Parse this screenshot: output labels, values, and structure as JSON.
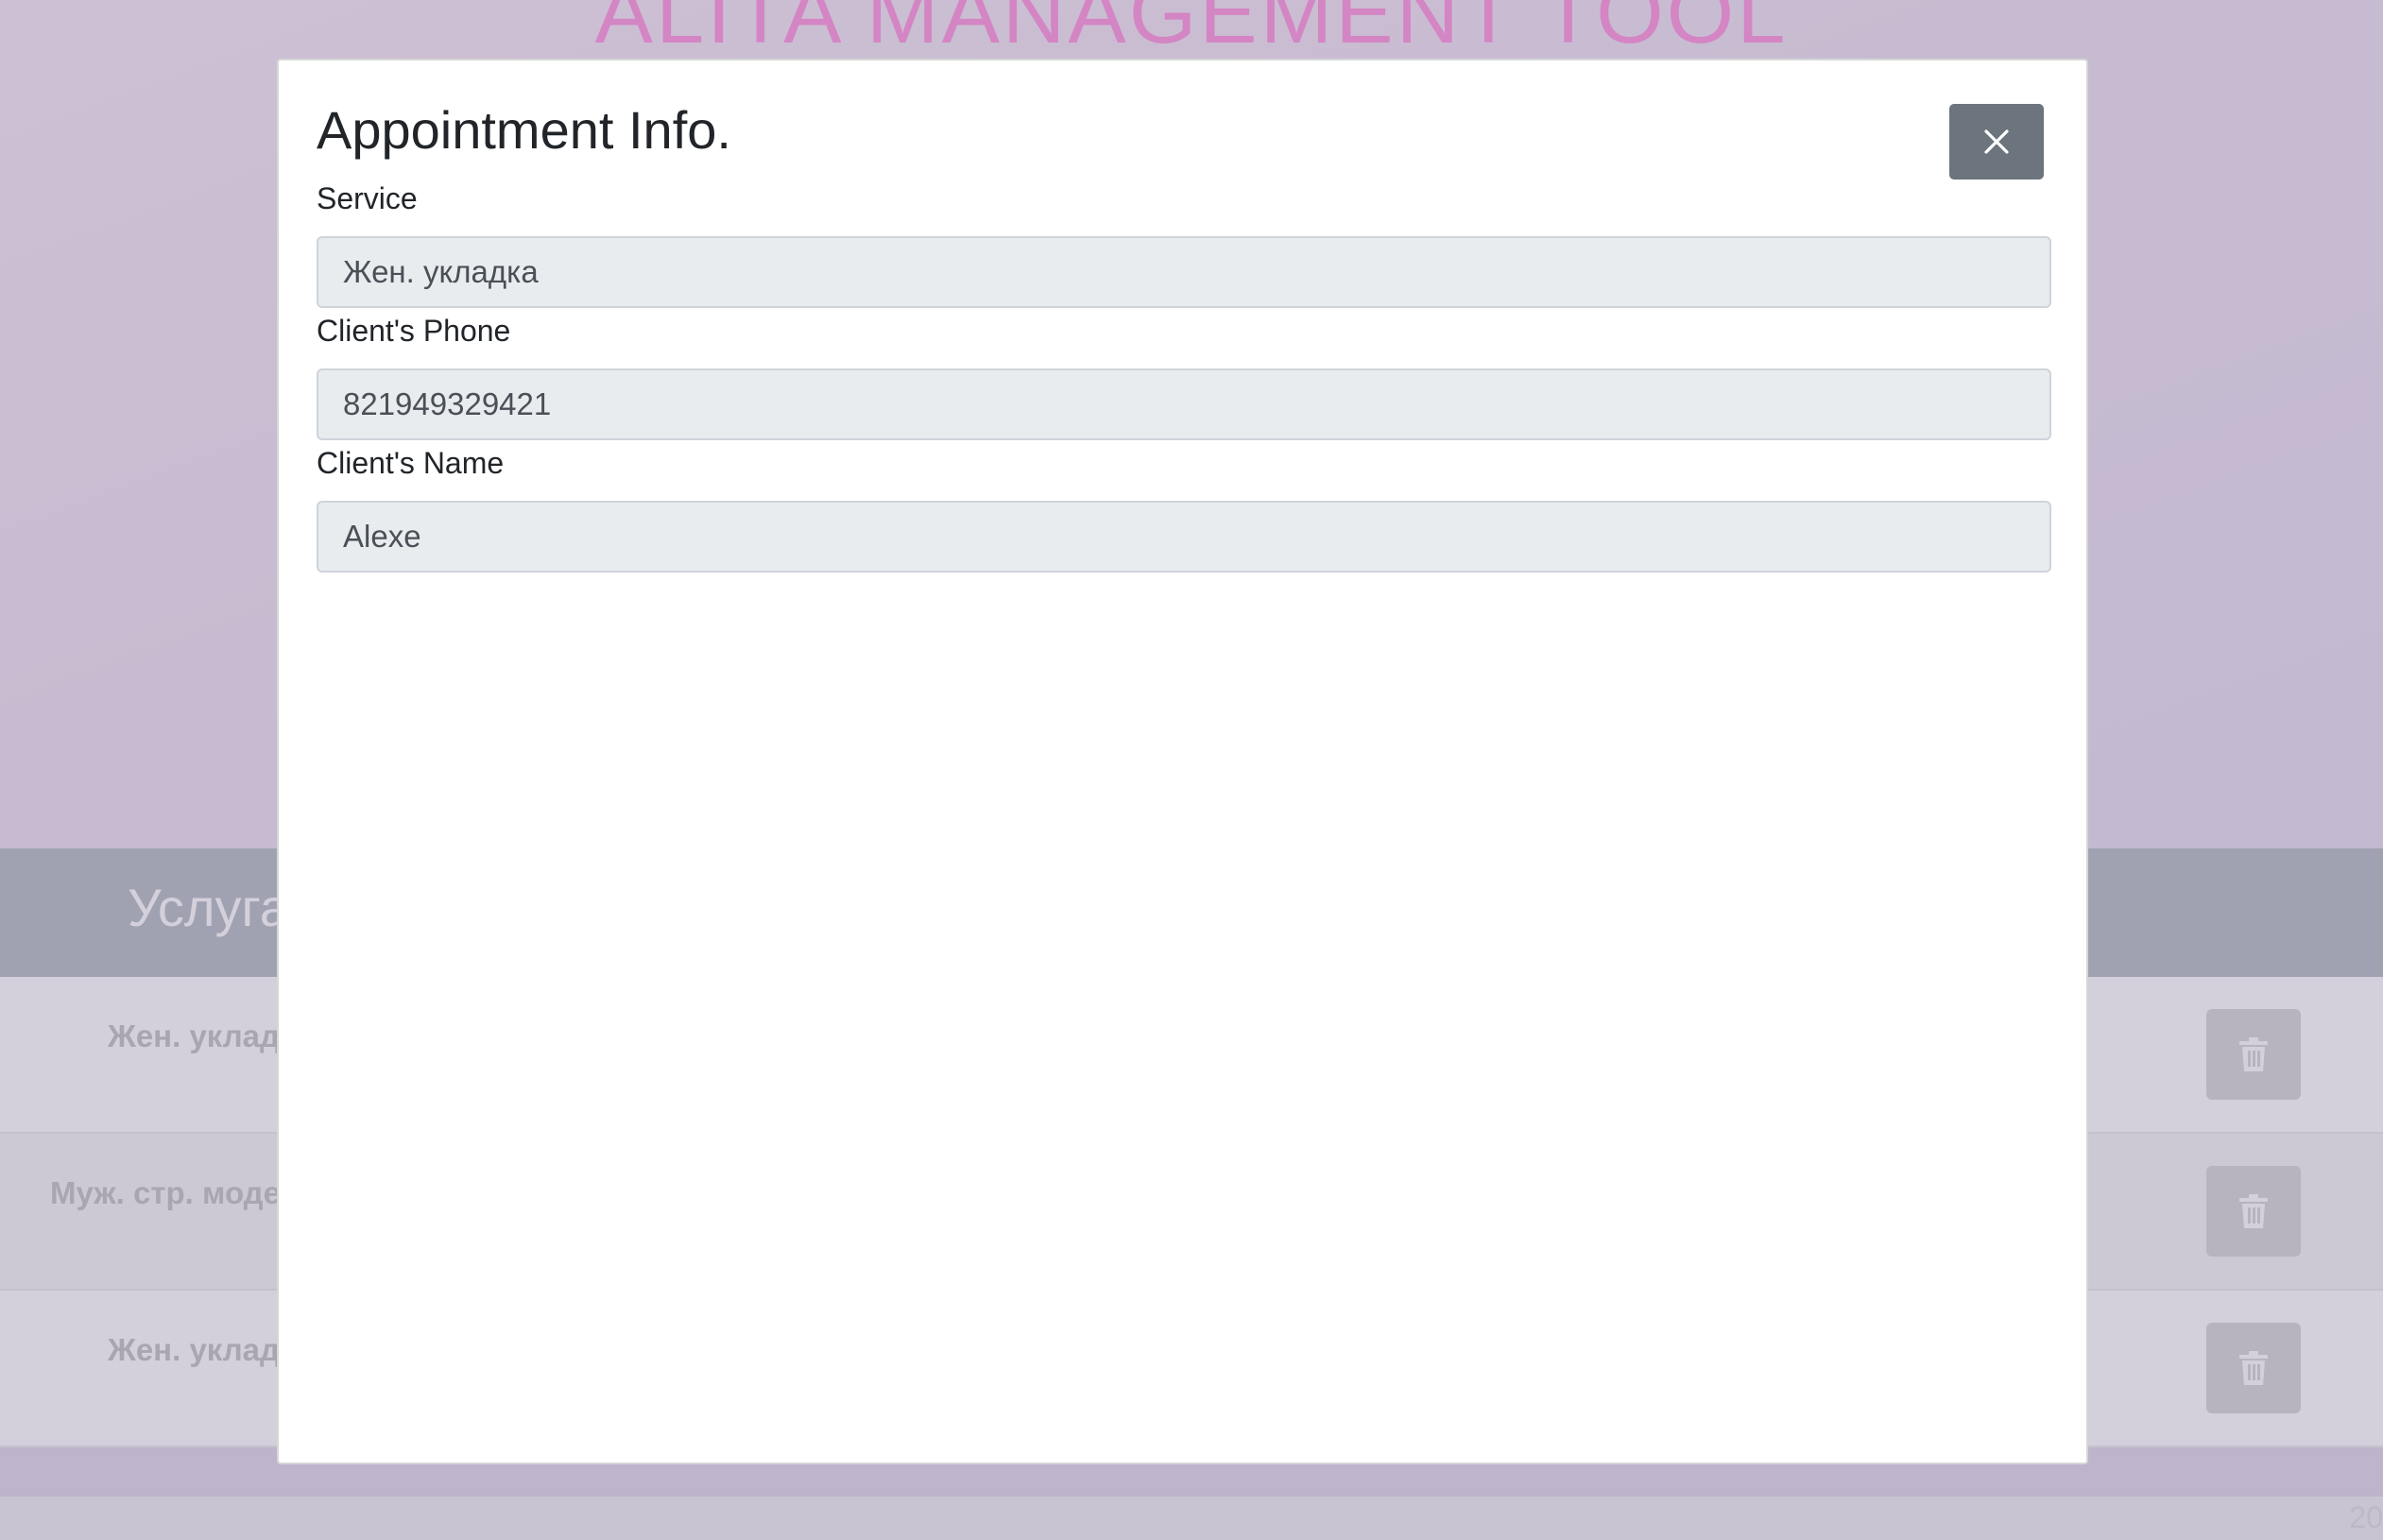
{
  "app": {
    "title": "ALITA MANAGEMENT TOOL",
    "year": "20"
  },
  "table": {
    "header": "Услуга",
    "rows": [
      {
        "service": "Жен. укладка"
      },
      {
        "service": "Муж. стр. модельная"
      },
      {
        "service": "Жен. укладка"
      }
    ]
  },
  "icons": {
    "delete": "trash-icon",
    "close": "close-icon"
  },
  "modal": {
    "title": "Appointment Info.",
    "fields": {
      "service": {
        "label": "Service",
        "value": "Жен. укладка"
      },
      "phone": {
        "label": "Client's Phone",
        "value": "821949329421"
      },
      "name": {
        "label": "Client's Name",
        "value": "Alexe"
      }
    }
  },
  "colors": {
    "accent_title": "#ff9fe2",
    "close_button": "#6c757d",
    "input_background": "#e9ecef"
  }
}
